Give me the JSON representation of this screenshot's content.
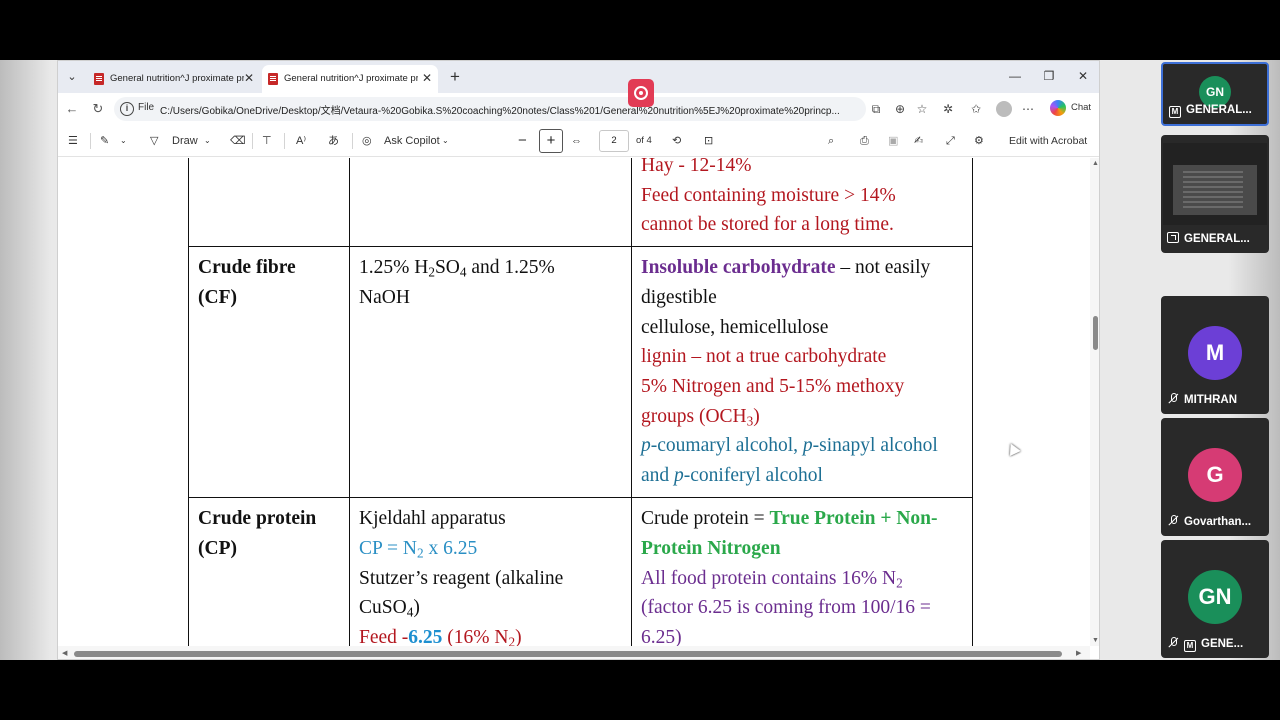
{
  "browser": {
    "tabs": [
      {
        "title": "General nutrition^J proximate princ",
        "active": false
      },
      {
        "title": "General nutrition^J proximate princ",
        "active": true
      }
    ],
    "address": {
      "scheme_label": "File",
      "url": "C:/Users/Gobika/OneDrive/Desktop/文档/Vetaura-%20Gobika.S%20coaching%20notes/Class%201/General%20nutrition%5EJ%20proximate%20princp..."
    },
    "chat_label": "Chat"
  },
  "pdf_toolbar": {
    "draw_label": "Draw",
    "ask_copilot_label": "Ask Copilot",
    "page_current": "2",
    "page_total": "of 4",
    "edit_acrobat_label": "Edit with Acrobat"
  },
  "document": {
    "row_top": {
      "c3": [
        "Hay - 12-14%",
        "Feed containing moisture > 14%",
        "cannot be stored for a long time."
      ]
    },
    "row_cf": {
      "title_1": "Crude fibre",
      "title_2": "(CF)",
      "method_pre": "1.25% H",
      "method_sub1": "2",
      "method_mid": "SO",
      "method_sub2": "4",
      "method_post": " and 1.25%",
      "method_line2": "NaOH",
      "desc_bold": "Insoluble carbohydrate",
      "desc_rest": " – not easily",
      "desc_l2": "digestible",
      "desc_l3": "cellulose, hemicellulose",
      "desc_l4": " lignin – not a true carbohydrate",
      "desc_l5": "5% Nitrogen and 5-15% methoxy",
      "desc_l6_pre": "groups (OCH",
      "desc_l6_sub": "3",
      "desc_l6_post": ")",
      "desc_l7_p1": "p",
      "desc_l7_t1": "-coumaryl alcohol, ",
      "desc_l7_p2": "p",
      "desc_l7_t2": "-sinapyl alcohol",
      "desc_l8_t1": "and ",
      "desc_l8_p": "p",
      "desc_l8_t2": "-coniferyl alcohol"
    },
    "row_cp": {
      "title_1": "Crude protein",
      "title_2": "(CP)",
      "m_l1": "Kjeldahl apparatus",
      "m_l2_pre": "CP = N",
      "m_l2_sub": "2",
      "m_l2_post": " x 6.25",
      "m_l3": "Stutzer’s reagent (alkaline",
      "m_l4_pre": "CuSO",
      "m_l4_sub": "4",
      "m_l4_post": ")",
      "m_l5_pre": "Feed -",
      "m_l5_num": "6.25",
      "m_l5_mid": " (16% N",
      "m_l5_sub": "2",
      "m_l5_post": ")",
      "d_l1_pre": "Crude protein = ",
      "d_l1_bold": "True Protein + Non-",
      "d_l2": "Protein Nitrogen",
      "d_l3_pre": "All food protein contains 16% N",
      "d_l3_sub": "2",
      "d_l4": "(factor 6.25 is coming from 100/16 =",
      "d_l5": "6.25)"
    }
  },
  "participants": [
    {
      "initials": "GN",
      "name": "GENERAL...",
      "color": "#1a8f5a",
      "badge": "M"
    },
    {
      "name": "GENERAL...",
      "type": "screen-share"
    },
    {
      "initials": "M",
      "name": "MITHRAN",
      "color": "#6c3fd6"
    },
    {
      "initials": "G",
      "name": "Govarthan...",
      "color": "#d63b74"
    },
    {
      "initials": "GN",
      "name": "GENE...",
      "color": "#1a8f5a",
      "badge": "M"
    }
  ]
}
